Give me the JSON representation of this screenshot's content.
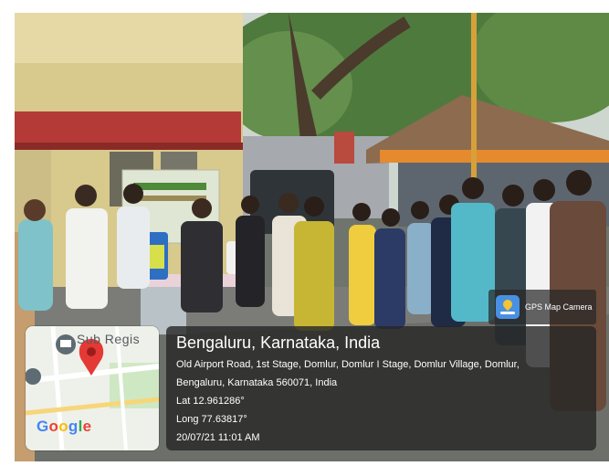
{
  "badge": {
    "text": "GPS Map Camera",
    "icon": "gps-map-camera-icon"
  },
  "map": {
    "street_label": "Sub Regis",
    "brand_letters": [
      "G",
      "o",
      "o",
      "g",
      "l",
      "e"
    ],
    "pin_color": "#e53935"
  },
  "location": {
    "city": "Bengaluru, Karnataka, India",
    "address_line1": "Old Airport Road, 1st Stage, Domlur, Domlur I Stage, Domlur Village, Domlur,",
    "address_line2": "Bengaluru, Karnataka 560071, India",
    "latitude": "Lat 12.961286°",
    "longitude": "Long 77.63817°",
    "datetime": "20/07/21 11:01 AM"
  },
  "colors": {
    "overlay": "#262626",
    "accent_orange": "#e58a2e",
    "wall": "#d8c98d",
    "red_band": "#b33a36"
  }
}
